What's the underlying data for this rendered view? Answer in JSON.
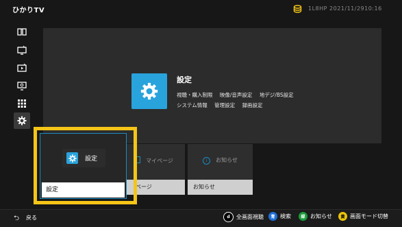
{
  "header": {
    "logo": "ひかりTV",
    "account_info": "1L8HP 2021/11/2910:16",
    "colors": {
      "coin": "#f5c518"
    }
  },
  "sidebar": {
    "items": [
      {
        "icon": "book-icon"
      },
      {
        "icon": "tv-icon"
      },
      {
        "icon": "video-icon"
      },
      {
        "icon": "monitor-icon"
      },
      {
        "icon": "grid-icon"
      },
      {
        "icon": "gear-icon",
        "active": true
      }
    ]
  },
  "hero": {
    "title": "設定",
    "line1": [
      "視聴・購入制限",
      "映像/音声設定",
      "地デジ/BS設定"
    ],
    "line2": [
      "システム情報",
      "管理設定",
      "録画設定"
    ],
    "accent": "#29a3dc"
  },
  "cards": {
    "focused": {
      "title": "設定",
      "label": "設定"
    },
    "mypage": {
      "title": "マイページ",
      "label": "ページ"
    },
    "notice": {
      "title": "お知らせ",
      "label": "お知らせ"
    },
    "focus_color": "#f5c518"
  },
  "footer": {
    "back": "戻る",
    "hints": [
      {
        "key": "d",
        "label": "全画面視聴",
        "color": "#000000"
      },
      {
        "key": "青",
        "label": "検索",
        "color": "#1f6fd6"
      },
      {
        "key": "緑",
        "label": "お知らせ",
        "color": "#1a9b3a"
      },
      {
        "key": "黄",
        "label": "画面モード切替",
        "color": "#e8c20a"
      }
    ]
  }
}
